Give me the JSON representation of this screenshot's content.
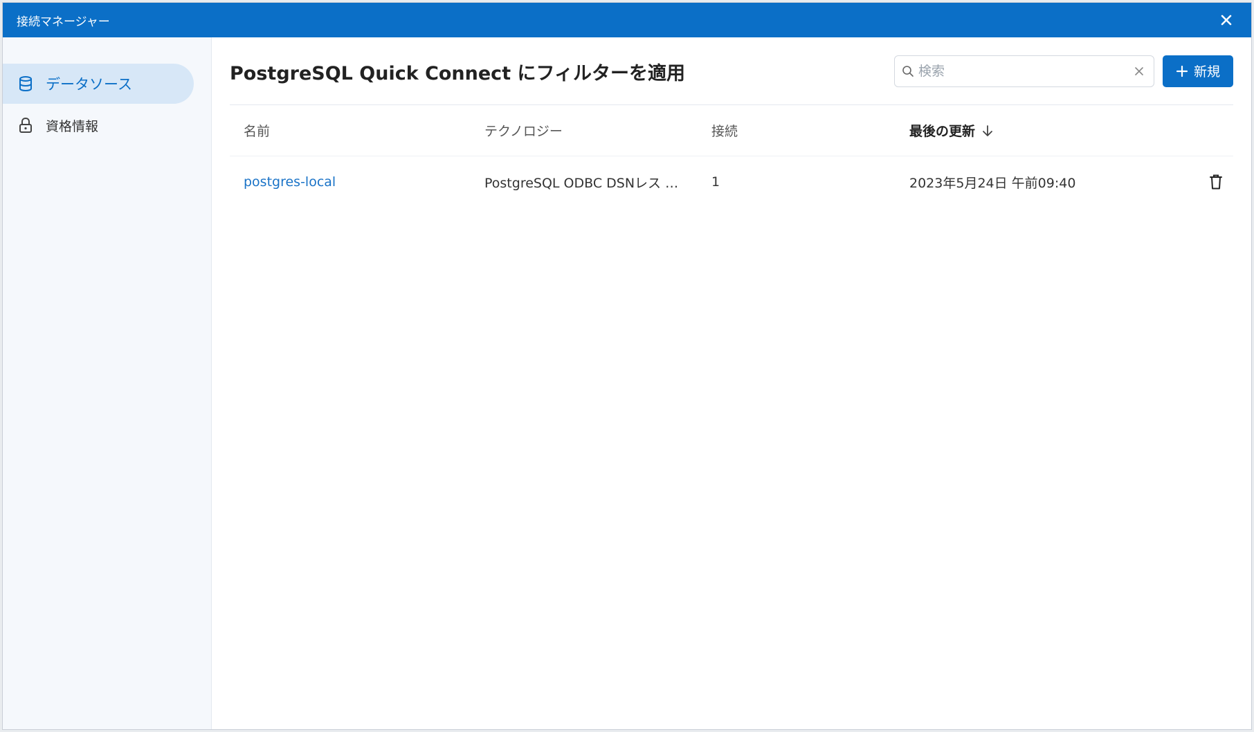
{
  "window": {
    "title": "接続マネージャー"
  },
  "sidebar": {
    "items": [
      {
        "label": "データソース",
        "icon": "database-icon",
        "active": true
      },
      {
        "label": "資格情報",
        "icon": "lock-icon",
        "active": false
      }
    ]
  },
  "main": {
    "title": "PostgreSQL Quick Connect にフィルターを適用",
    "search": {
      "placeholder": "検索",
      "value": ""
    },
    "new_button_label": "新規"
  },
  "table": {
    "columns": {
      "name": "名前",
      "technology": "テクノロジー",
      "connections": "接続",
      "last_updated": "最後の更新"
    },
    "sort": {
      "column": "last_updated",
      "direction": "descending"
    },
    "rows": [
      {
        "name": "postgres-local",
        "technology": "PostgreSQL ODBC DSNレス …",
        "connections": "1",
        "last_updated": "2023年5月24日 午前09:40"
      }
    ]
  },
  "colors": {
    "accent": "#0b6fc7",
    "link": "#1a73c7",
    "sidebar_active": "#d7e7f7"
  }
}
